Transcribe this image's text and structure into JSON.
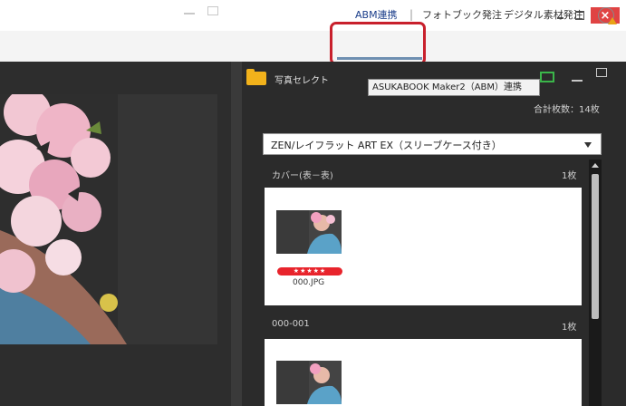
{
  "window": {
    "close_glyph": "×"
  },
  "toolbar": {
    "abm_label": "ABM連携",
    "separator": "|",
    "photobook_label": "フォトブック発注",
    "digital_label": "デジタル素材発注",
    "globe_icon": "globe-warning-icon"
  },
  "tooltip": {
    "text": "ASUKABOOK Maker2（ABM）連携"
  },
  "panel": {
    "title": "写真セレクト",
    "total": "合計枚数：14枚",
    "product_select": "ZEN/レイフラット ART EX（スリーブケース付き）"
  },
  "sections": [
    {
      "label": "カバー(表－表)",
      "count": "1枚",
      "thumbnail": {
        "stars": "★★★★★",
        "filename": "000.JPG"
      }
    },
    {
      "label": "000-001",
      "count": "1枚"
    }
  ],
  "colors": {
    "highlight": "#c8202c",
    "close": "#e04343",
    "folder": "#f2b21b",
    "stars": "#e8242c"
  }
}
